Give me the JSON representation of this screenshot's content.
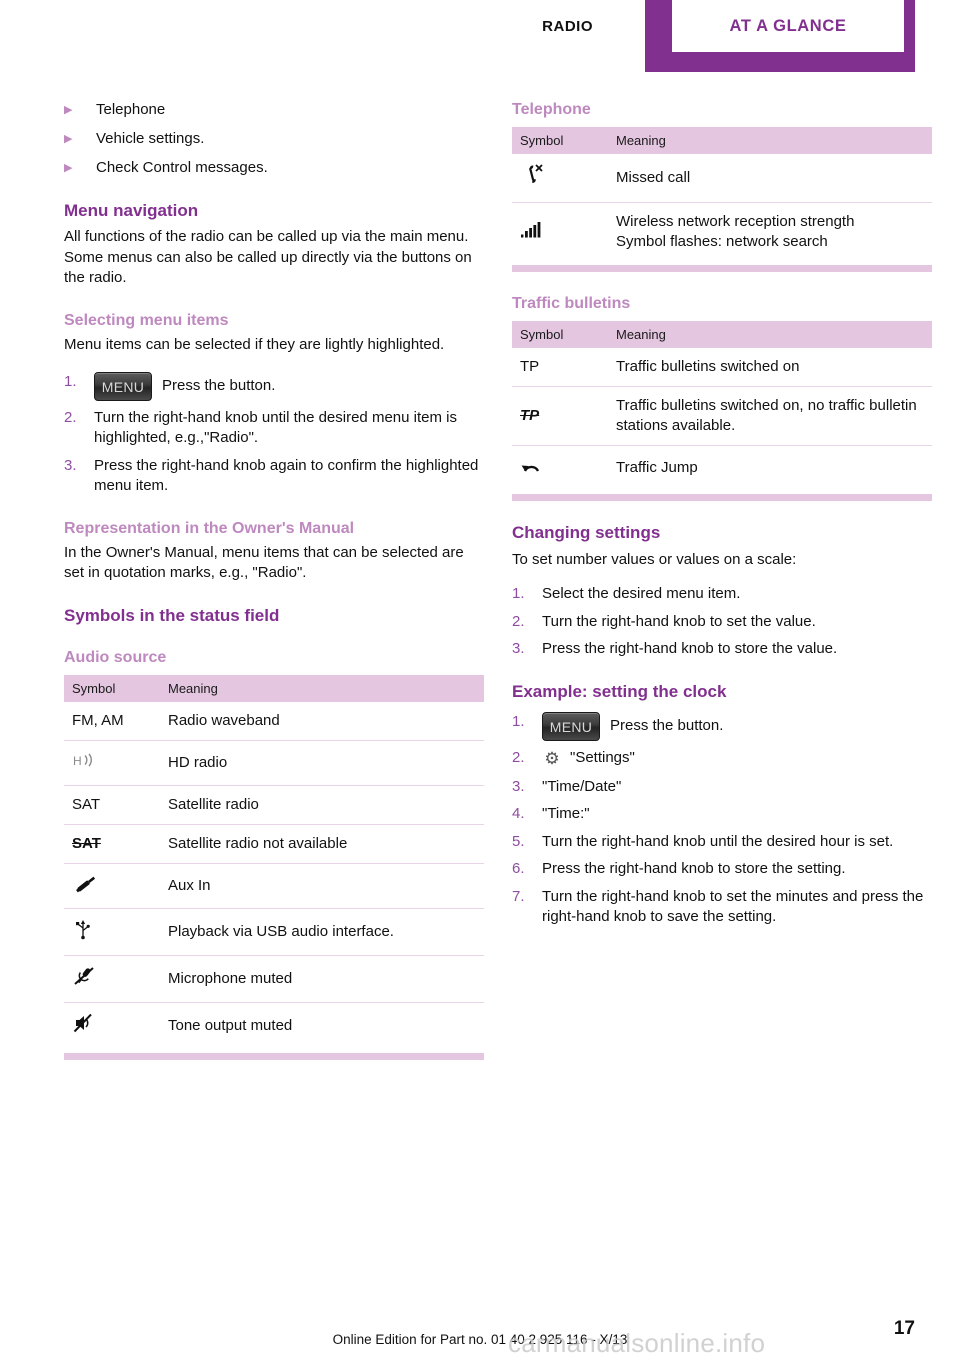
{
  "header": {
    "chapter": "RADIO",
    "section_tab": "AT A GLANCE",
    "accent_color": "#82308F",
    "tab_bg": "#ffffff"
  },
  "left_column": {
    "intro_bullets": [
      "Telephone",
      "Vehicle settings.",
      "Check Control messages."
    ],
    "menu_navigation": {
      "heading": "Menu navigation",
      "body": "All functions of the radio can be called up via the main menu. Some menus can also be called up directly via the buttons on the radio."
    },
    "selecting_menu_items": {
      "heading": "Selecting menu items",
      "body": "Menu items can be selected if they are lightly highlighted.",
      "steps": [
        {
          "num": "1.",
          "button": "MENU",
          "text": "Press the button."
        },
        {
          "num": "2.",
          "text": "Turn the right-hand knob until the desired menu item is highlighted, e.g.,\"Radio\"."
        },
        {
          "num": "3.",
          "text": "Press the right-hand knob again to confirm the highlighted menu item."
        }
      ]
    },
    "representation": {
      "heading": "Representation in the Owner's Manual",
      "body": "In the Owner's Manual, menu items that can be selected are set in quotation marks, e.g., \"Radio\"."
    },
    "symbols_status_field": {
      "heading": "Symbols in the status field"
    },
    "audio_source": {
      "heading": "Audio source",
      "columns": [
        "Symbol",
        "Meaning"
      ],
      "rows": [
        {
          "symbol": "FM, AM",
          "symbol_type": "text",
          "meaning": "Radio waveband"
        },
        {
          "symbol": "hd-radio-icon",
          "symbol_type": "icon",
          "meaning": "HD radio"
        },
        {
          "symbol": "SAT",
          "symbol_type": "text",
          "meaning": "Satellite radio"
        },
        {
          "symbol": "SAT",
          "symbol_type": "text-strike",
          "meaning": "Satellite radio not available"
        },
        {
          "symbol": "aux-plug-icon",
          "symbol_type": "icon",
          "meaning": "Aux In"
        },
        {
          "symbol": "usb-icon",
          "symbol_type": "icon",
          "meaning": "Playback via USB audio interface."
        },
        {
          "symbol": "microphone-muted-icon",
          "symbol_type": "icon",
          "meaning": "Microphone muted"
        },
        {
          "symbol": "speaker-muted-icon",
          "symbol_type": "icon",
          "meaning": "Tone output muted"
        }
      ]
    }
  },
  "right_column": {
    "telephone": {
      "heading": "Telephone",
      "columns": [
        "Symbol",
        "Meaning"
      ],
      "rows": [
        {
          "symbol": "missed-call-icon",
          "symbol_type": "icon",
          "meaning": "Missed call"
        },
        {
          "symbol": "signal-bars-icon",
          "symbol_type": "icon",
          "meaning": "Wireless network reception strength",
          "meaning2": "Symbol flashes: network search"
        }
      ]
    },
    "traffic_bulletins": {
      "heading": "Traffic bulletins",
      "columns": [
        "Symbol",
        "Meaning"
      ],
      "rows": [
        {
          "symbol": "TP",
          "symbol_type": "text",
          "meaning": "Traffic bulletins switched on"
        },
        {
          "symbol": "TP",
          "symbol_type": "text-strike",
          "meaning": "Traffic bulletins switched on, no traffic bulletin stations available."
        },
        {
          "symbol": "traffic-jump-icon",
          "symbol_type": "icon",
          "meaning": "Traffic Jump"
        }
      ]
    },
    "changing_settings": {
      "heading": "Changing settings",
      "body": "To set number values or values on a scale:",
      "steps": [
        {
          "num": "1.",
          "text": "Select the desired menu item."
        },
        {
          "num": "2.",
          "text": "Turn the right-hand knob to set the value."
        },
        {
          "num": "3.",
          "text": "Press the right-hand knob to store the value."
        }
      ]
    },
    "example_clock": {
      "heading": "Example: setting the clock",
      "steps": [
        {
          "num": "1.",
          "button": "MENU",
          "text": "Press the button."
        },
        {
          "num": "2.",
          "icon": "gear-icon",
          "text": "\"Settings\""
        },
        {
          "num": "3.",
          "text": "\"Time/Date\""
        },
        {
          "num": "4.",
          "text": "\"Time:\""
        },
        {
          "num": "5.",
          "text": "Turn the right-hand knob until the desired hour is set."
        },
        {
          "num": "6.",
          "text": "Press the right-hand knob to store the setting."
        },
        {
          "num": "7.",
          "text": "Turn the right-hand knob to set the minutes and press the right-hand knob to save the setting."
        }
      ]
    }
  },
  "footer": {
    "edition": "Online Edition for Part no. 01 40 2 925 116 - X/13",
    "page_number": "17",
    "watermark": "carmanualsonline.info"
  }
}
